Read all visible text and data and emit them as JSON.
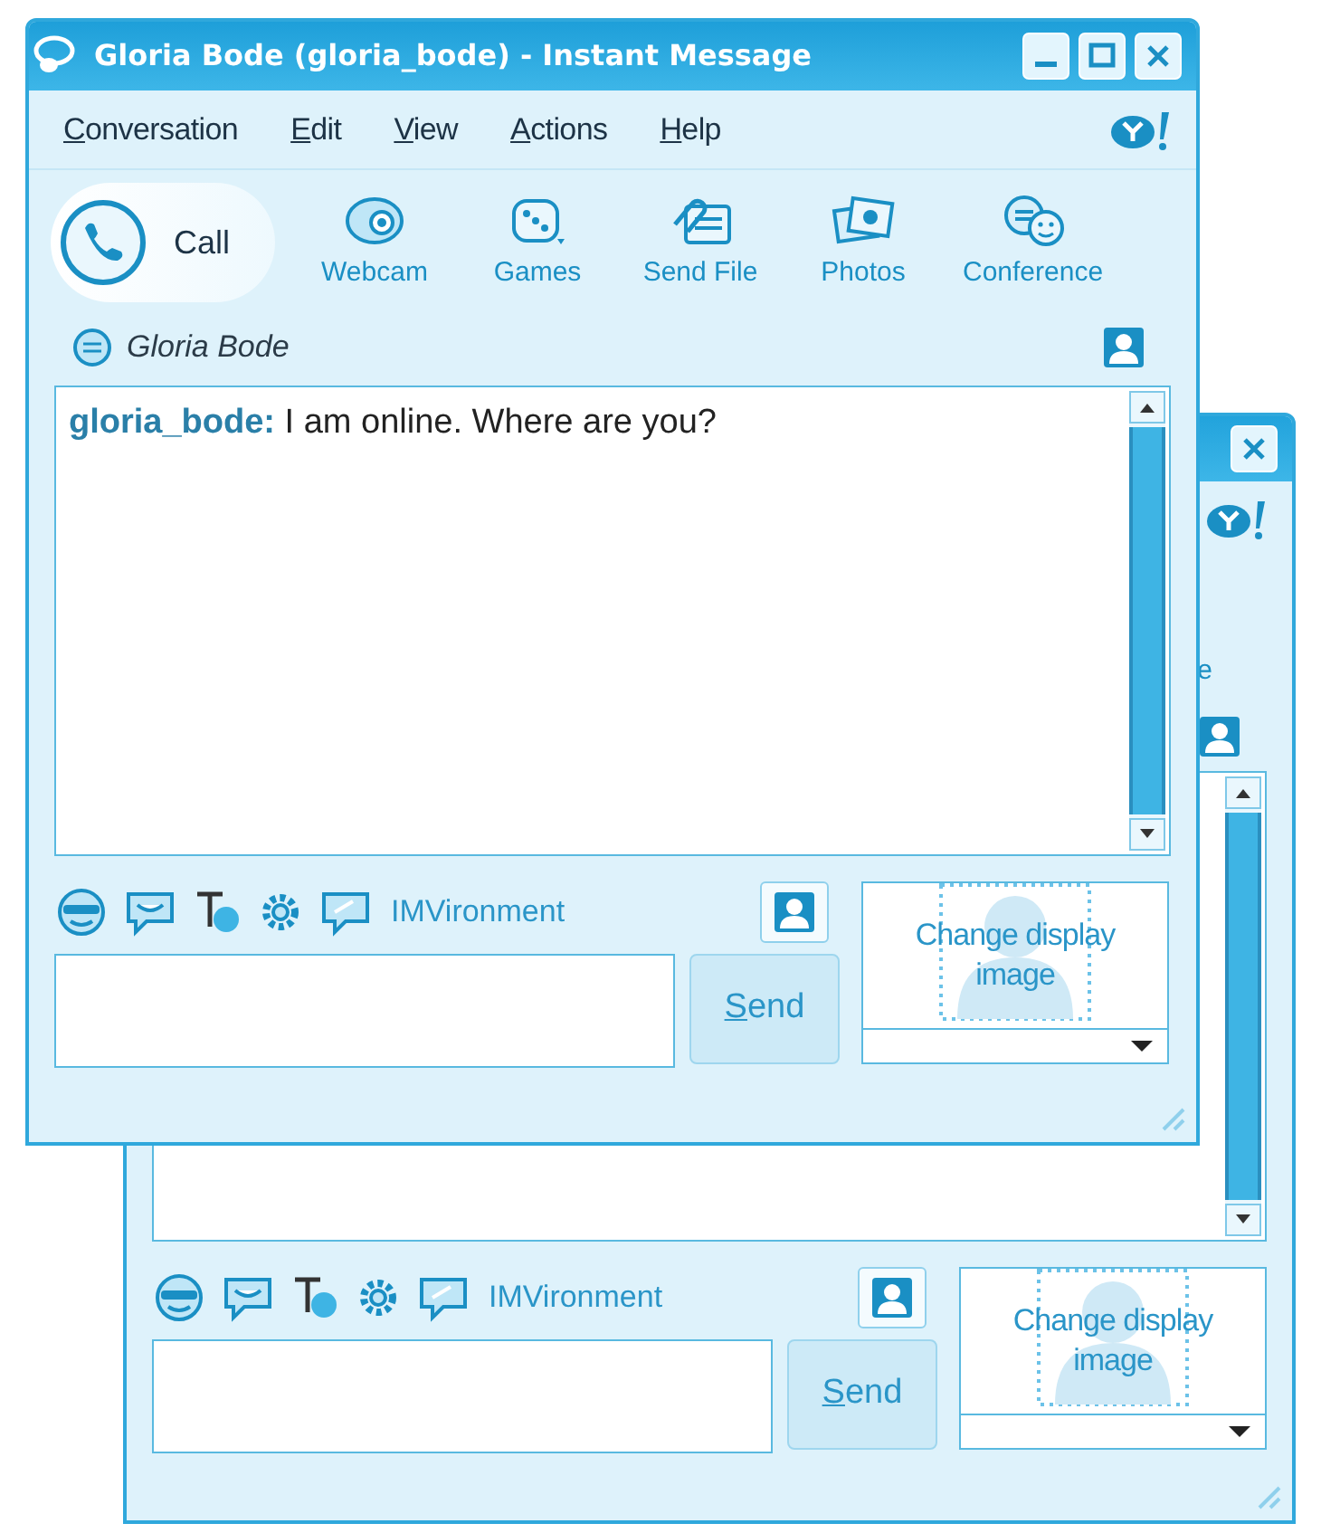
{
  "back_window": {
    "toolbar_fragment": "e",
    "format_bar": {
      "label": "IMVironment"
    },
    "send_button": {
      "label": "Send"
    },
    "display_image": {
      "label": "Change display image"
    }
  },
  "front_window": {
    "title": "Gloria Bode (gloria_bode) - Instant Message",
    "menu": [
      "Conversation",
      "Edit",
      "View",
      "Actions",
      "Help"
    ],
    "toolbar": [
      {
        "kind": "call",
        "label": "Call"
      },
      {
        "kind": "webcam",
        "label": "Webcam"
      },
      {
        "kind": "games",
        "label": "Games"
      },
      {
        "kind": "send_file",
        "label": "Send File"
      },
      {
        "kind": "photos",
        "label": "Photos"
      },
      {
        "kind": "conference",
        "label": "Conference"
      }
    ],
    "buddy": {
      "name": "Gloria Bode"
    },
    "messages": [
      {
        "text": "**gloria_bode:** I am online. Where are you?"
      }
    ],
    "format_bar": {
      "label": "IMVironment"
    },
    "send_button": {
      "label": "Send"
    },
    "display_image": {
      "label": "Change display image"
    }
  }
}
